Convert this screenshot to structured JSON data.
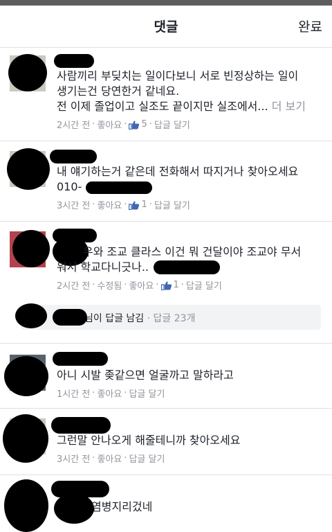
{
  "header": {
    "title": "댓글",
    "done_label": "완료"
  },
  "comments": [
    {
      "lines": [
        "사람끼리 부딪치는 일이다보니 서로 빈정상하는 일이",
        "생기는건 당연한거 같네요.",
        "전 이제 졸업이고 실조도 끝이지만 실조에서..."
      ],
      "more_label": "더 보기",
      "time": "2시간 전",
      "like": "좋아요",
      "like_count": "5",
      "reply": "답글 달기"
    },
    {
      "lines": [
        "내 얘기하는거 같은데 전화해서 따지거나 찾아오세요",
        "010-"
      ],
      "time": "3시간 전",
      "like": "좋아요",
      "like_count": "1",
      "reply": "답글 달기"
    },
    {
      "lines": [
        "우와 조교 클라스 이건 뭐 건달이야 조교야 무서",
        "워서 학교다니긋나.."
      ],
      "time": "2시간 전",
      "edited": "수정됨",
      "like": "좋아요",
      "like_count": "1",
      "reply": "답글 달기",
      "reply_summary": {
        "text": "님이 답글 남김",
        "sep": "·",
        "count": "답글 23개"
      }
    },
    {
      "lines": [
        "아니 시발 좆같으면 얼굴까고 말하라고"
      ],
      "time": "1시간 전",
      "like": "좋아요",
      "reply": "답글 달기"
    },
    {
      "lines": [
        "그런말 안나오게 해줄테니까 찾아오세요"
      ],
      "time": "3시간 전",
      "like": "좋아요",
      "reply": "답글 달기"
    },
    {
      "lines": [
        "염병지리겄네"
      ]
    }
  ],
  "colors": {
    "meta_gray": "#90949c",
    "text": "#1d2129",
    "like_blue": "#4267b2"
  }
}
